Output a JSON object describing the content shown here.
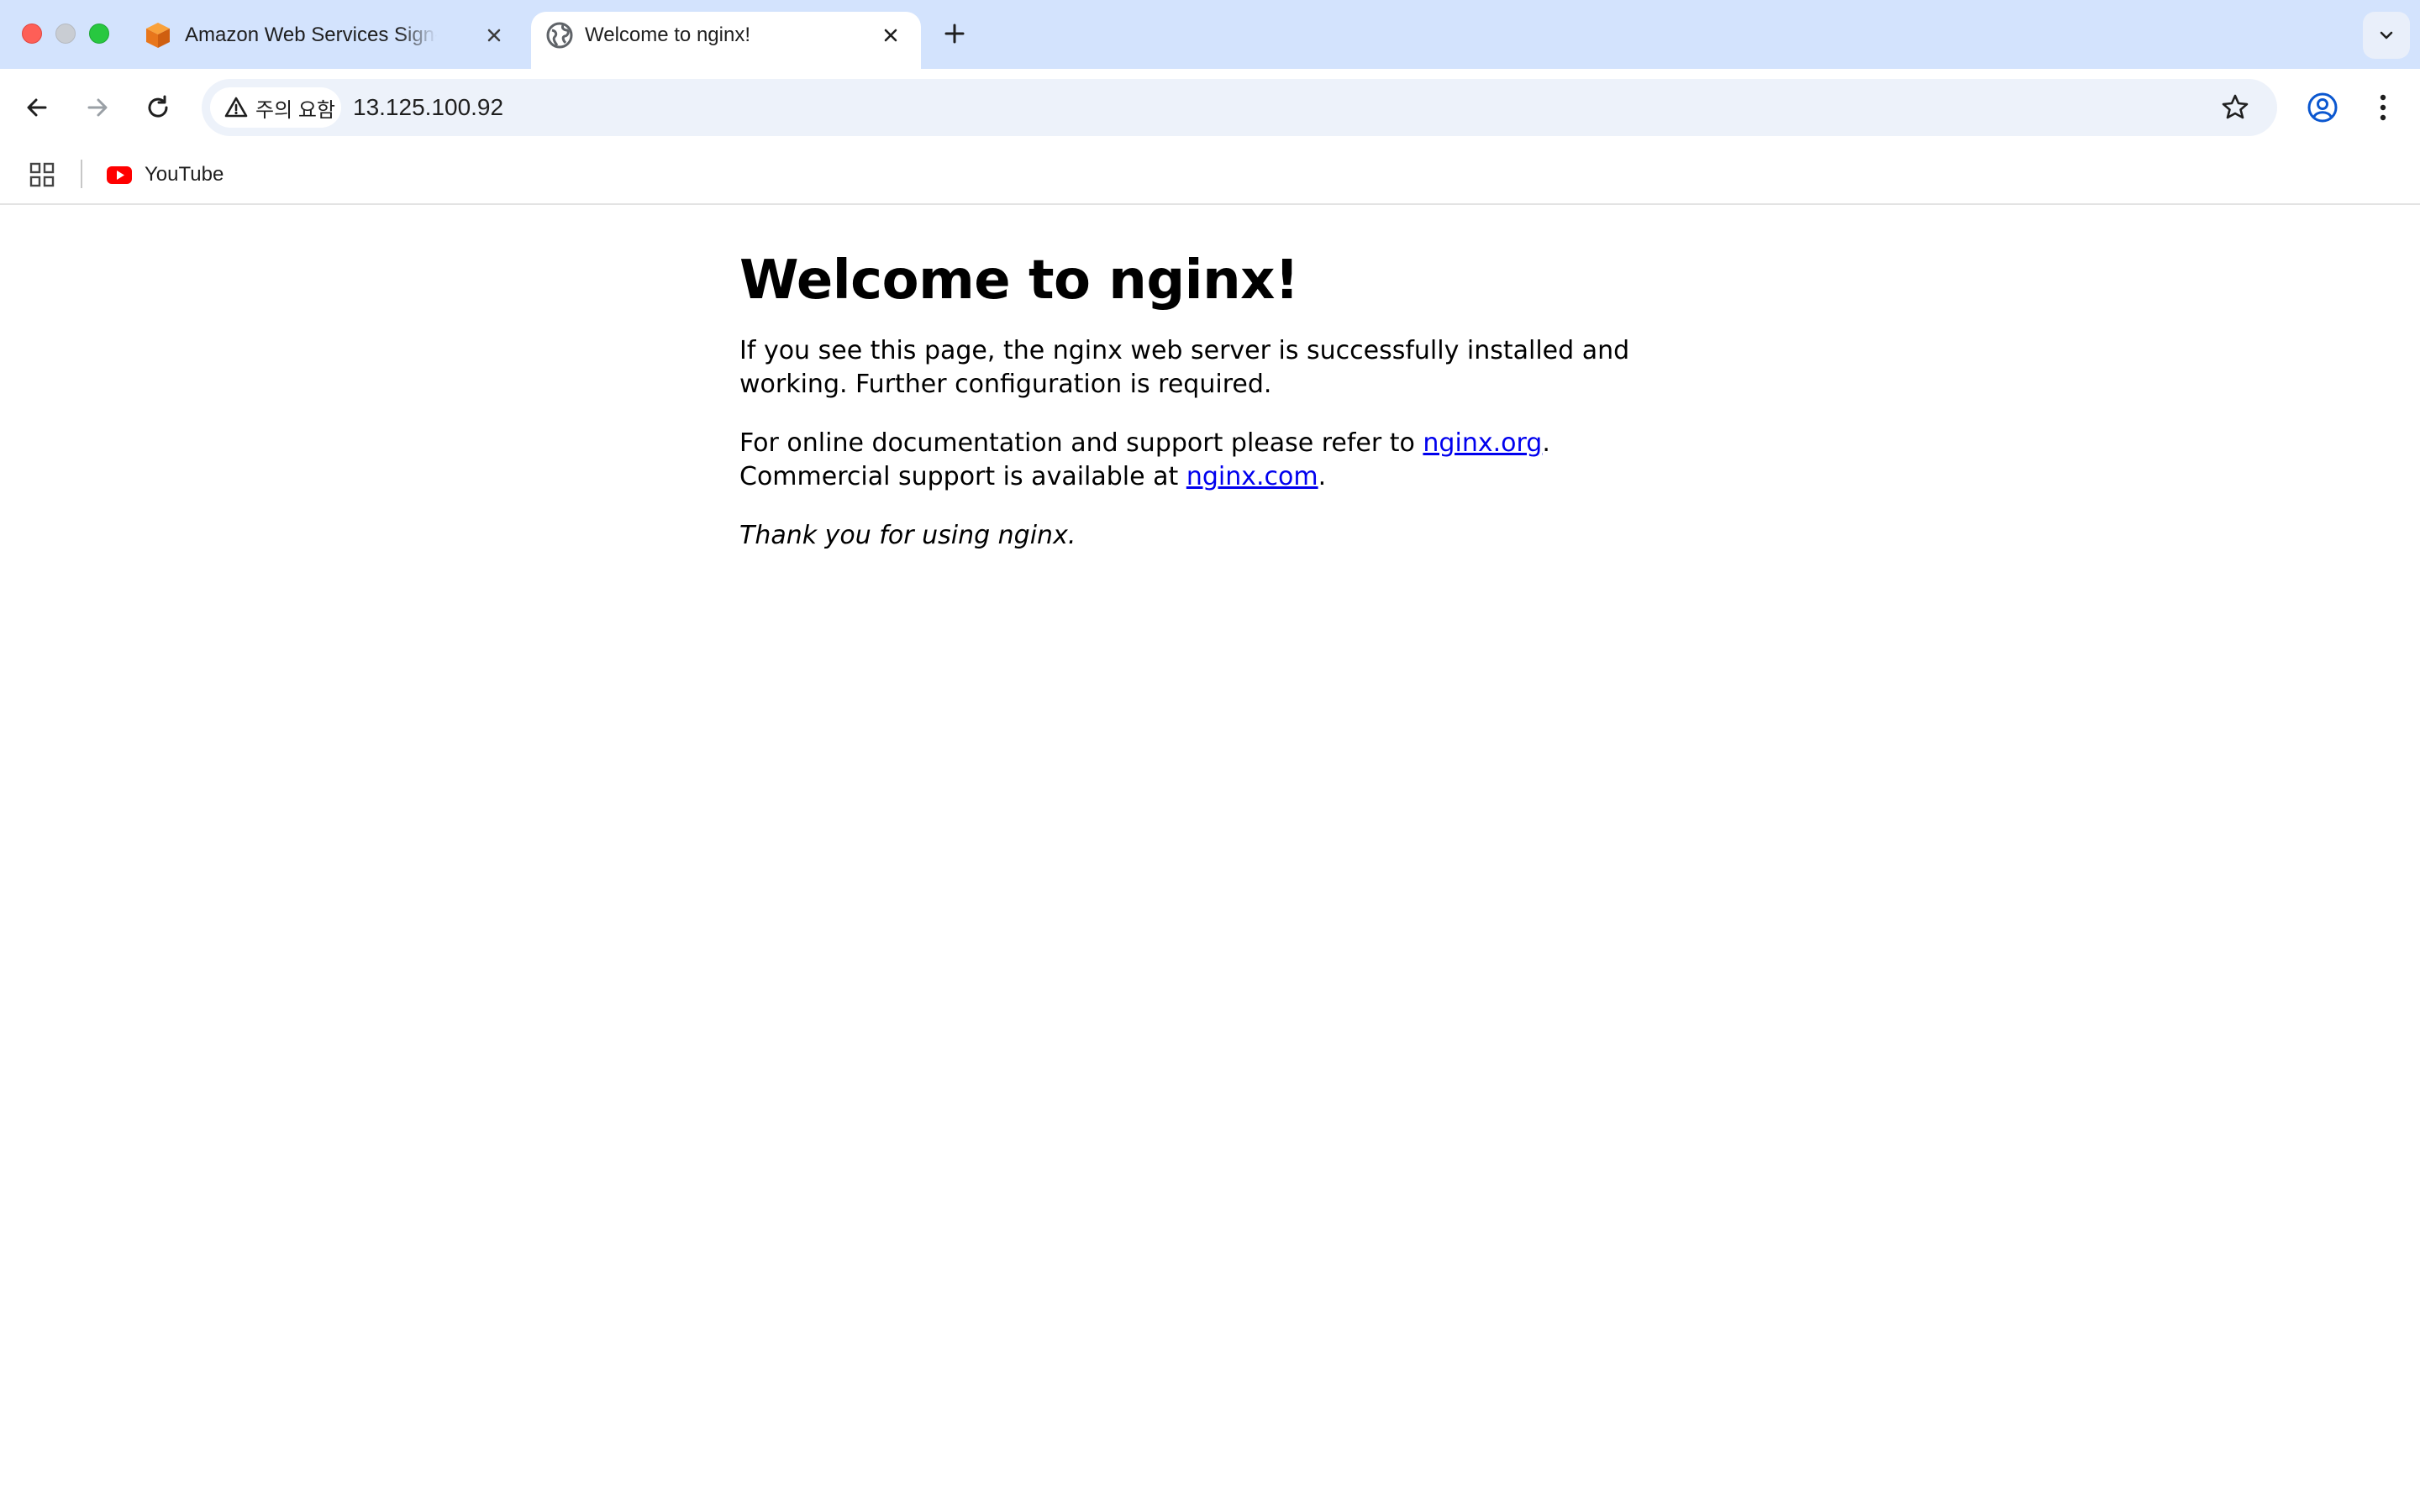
{
  "tabs": [
    {
      "title": "Amazon Web Services Sign-In",
      "favicon": "aws-cube-icon",
      "active": false
    },
    {
      "title": "Welcome to nginx!",
      "favicon": "globe-icon",
      "active": true
    }
  ],
  "toolbar": {
    "security_chip": "주의 요함",
    "url": "13.125.100.92"
  },
  "bookmarks": [
    {
      "label": "YouTube",
      "icon": "youtube-icon"
    }
  ],
  "colors": {
    "tabstrip_bg": "#d3e3fd",
    "omnibox_bg": "#edf2fa",
    "link": "#0000ee"
  },
  "page": {
    "heading": "Welcome to nginx!",
    "p1": "If you see this page, the nginx web server is successfully installed and working. Further configuration is required.",
    "p2_before": "For online documentation and support please refer to ",
    "p2_link1": "nginx.org",
    "p2_middle": ".",
    "p2_line2": "Commercial support is available at ",
    "p2_link2": "nginx.com",
    "p2_end": ".",
    "p3": "Thank you for using nginx."
  }
}
